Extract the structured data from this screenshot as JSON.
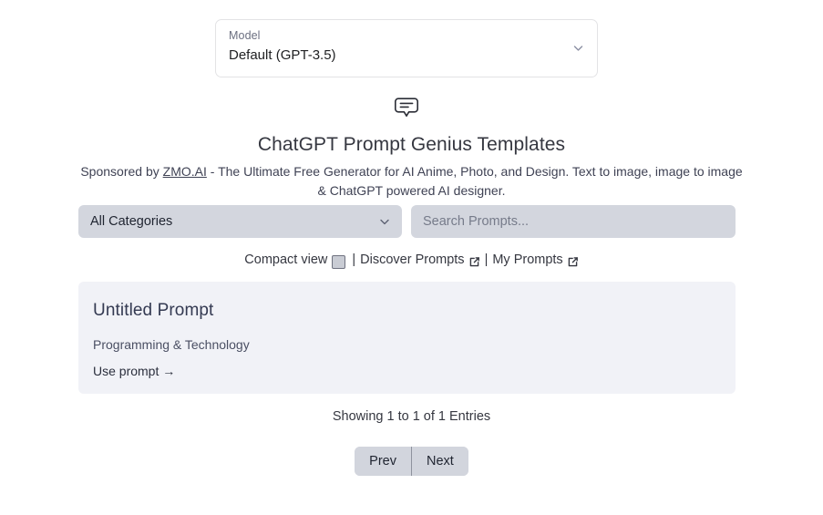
{
  "model_selector": {
    "label": "Model",
    "value": "Default (GPT-3.5)",
    "chevron_icon": "chevron-down-icon"
  },
  "header": {
    "icon": "speech-bubble-icon",
    "title": "ChatGPT Prompt Genius Templates",
    "subtitle_prefix": "Sponsored by ",
    "subtitle_link": "ZMO.AI",
    "subtitle_suffix": " - The Ultimate Free Generator for AI Anime, Photo, and Design. Text to image, image to image & ChatGPT powered AI designer."
  },
  "filters": {
    "category": {
      "value": "All Categories",
      "chevron_icon": "chevron-down-icon"
    },
    "search": {
      "value": "",
      "placeholder": "Search Prompts..."
    }
  },
  "options": {
    "compact_view_label": "Compact view",
    "compact_view_checked": false,
    "separator": "|",
    "discover_prompts_label": "Discover Prompts",
    "my_prompts_label": "My Prompts",
    "external_icon": "external-link-icon"
  },
  "prompt_card": {
    "title": "Untitled Prompt",
    "category": "Programming & Technology",
    "action_label": "Use prompt →"
  },
  "footer": {
    "showing_text": "Showing 1 to 1 of 1 Entries",
    "prev_label": "Prev",
    "next_label": "Next"
  },
  "colors": {
    "page_background": "#ffffff",
    "control_background": "#d3d6de",
    "card_background": "#f1f2f7",
    "text_primary": "#353740",
    "card_title": "#343a52",
    "button_background": "#d2d5dd"
  }
}
